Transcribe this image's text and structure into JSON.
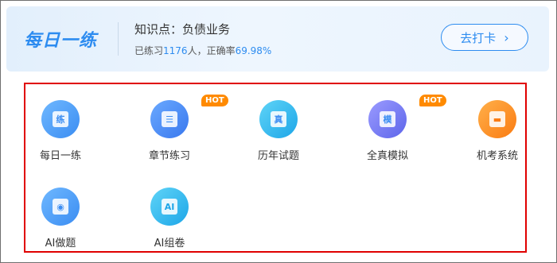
{
  "banner": {
    "brand": "每日一练",
    "topic": "知识点：负债业务",
    "stats_prefix": "已练习",
    "practice_count": "1176",
    "stats_mid": "人，正确率",
    "accuracy": "69.98%",
    "checkin_label": "去打卡",
    "checkin_chevron": "›"
  },
  "hot_badge": "HOT",
  "items": [
    {
      "label": "每日一练",
      "icon": "practice-icon",
      "glyph": "练"
    },
    {
      "label": "章节练习",
      "icon": "document-icon",
      "glyph": "☰"
    },
    {
      "label": "历年试题",
      "icon": "exam-paper-icon",
      "glyph": "真"
    },
    {
      "label": "全真模拟",
      "icon": "mock-exam-icon",
      "glyph": "模"
    },
    {
      "label": "机考系统",
      "icon": "computer-icon",
      "glyph": "▬"
    },
    {
      "label": "AI做题",
      "icon": "robot-icon",
      "glyph": "◉"
    },
    {
      "label": "AI组卷",
      "icon": "ai-paper-icon",
      "glyph": "AI"
    }
  ],
  "colors": {
    "accent": "#2d8cf0",
    "hot": "#ff8a00",
    "highlight_border": "#e00000"
  }
}
